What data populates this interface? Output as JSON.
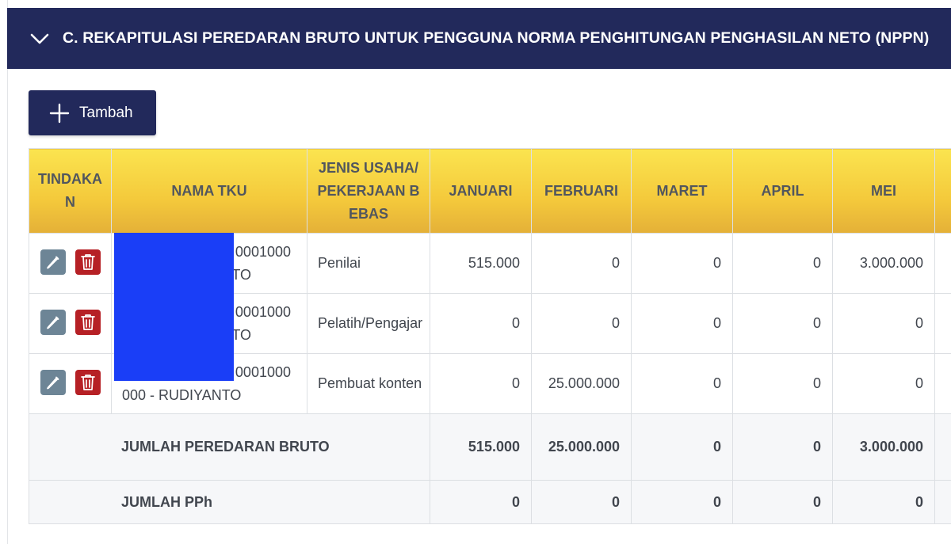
{
  "section": {
    "title": "C. REKAPITULASI PEREDARAN BRUTO UNTUK PENGGUNA NORMA PENGHITUNGAN PENGHASILAN NETO (NPPN)",
    "toggle_icon": "chevron-down-icon"
  },
  "toolbar": {
    "add_label": "Tambah",
    "add_icon": "plus-icon"
  },
  "colors": {
    "header_bg": "#22295b",
    "table_header_gradient_top": "#fbe44f",
    "table_header_gradient_bottom": "#e4b038",
    "edit_button": "#6d8596",
    "delete_button": "#b62025",
    "redaction": "#1a3ef7"
  },
  "table": {
    "headers": {
      "tindakan": "TINDAKAN",
      "nama_tku": "NAMA TKU",
      "jenis_usaha": "JENIS USAHA/PEKERJAAN BEBAS",
      "januari": "JANUARI",
      "februari": "FEBRUARI",
      "maret": "MARET",
      "april": "APRIL",
      "mei": "MEI"
    },
    "rows": [
      {
        "nama_tku_line1": "0001000",
        "nama_tku_line2": "TO",
        "jenis_usaha": "Penilai",
        "januari": "515.000",
        "februari": "0",
        "maret": "0",
        "april": "0",
        "mei": "3.000.000"
      },
      {
        "nama_tku_line1": "0001000",
        "nama_tku_line2": "TO",
        "jenis_usaha": "Pelatih/Pengajar",
        "januari": "0",
        "februari": "0",
        "maret": "0",
        "april": "0",
        "mei": "0"
      },
      {
        "nama_tku_line1": "0001000",
        "nama_tku_line2": "000 - RUDIYANTO",
        "jenis_usaha": "Pembuat konten",
        "januari": "0",
        "februari": "25.000.000",
        "maret": "0",
        "april": "0",
        "mei": "0"
      }
    ],
    "summary": {
      "label": "JUMLAH PEREDARAN BRUTO",
      "januari": "515.000",
      "februari": "25.000.000",
      "maret": "0",
      "april": "0",
      "mei": "3.000.000"
    },
    "pph": {
      "label": "JUMLAH PPh",
      "januari": "0",
      "februari": "0",
      "maret": "0",
      "april": "0",
      "mei": "0"
    }
  }
}
